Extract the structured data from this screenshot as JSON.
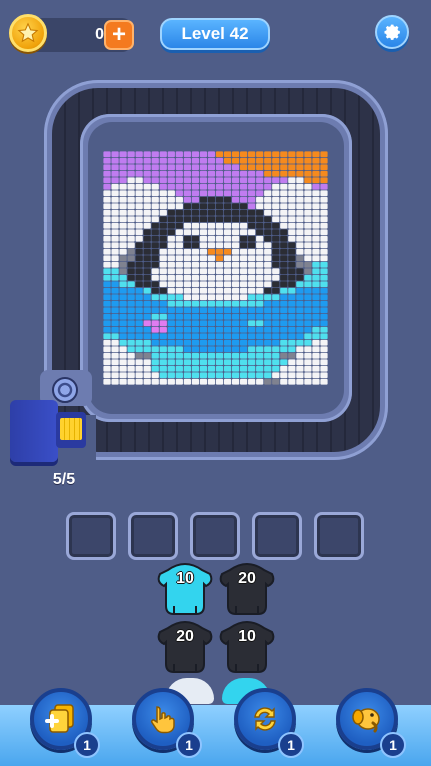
{
  "header": {
    "coins": "0",
    "coin_add_label": "+",
    "level_label": "Level 42",
    "icons": {
      "coin": "star-coin-icon",
      "settings": "gear-icon"
    }
  },
  "launcher": {
    "ammo_label": "5/5",
    "load_color": "#ffd22e"
  },
  "queue": {
    "slot_count": 5
  },
  "shooters": [
    {
      "count": "10",
      "color": "#33d4ee"
    },
    {
      "count": "20",
      "color": "#2b2d35"
    },
    {
      "count": "20",
      "color": "#2b2d35"
    },
    {
      "count": "10",
      "color": "#2b2d35"
    }
  ],
  "boosters": [
    {
      "icon": "add-blocks-icon",
      "count": "1"
    },
    {
      "icon": "tap-hand-icon",
      "count": "1"
    },
    {
      "icon": "shuffle-icon",
      "count": "1"
    },
    {
      "icon": "elephant-icon",
      "count": "1"
    }
  ],
  "palette": {
    "purple": "#c07cf0",
    "orange": "#f58a1e",
    "white": "#f4f4f6",
    "black": "#2b2d35",
    "gray": "#7f8290",
    "cyan": "#4fe0ee",
    "blue": "#1e9bf0",
    "pink": "#e07cf0",
    "peach": "#f5a35a"
  },
  "pixel_art": {
    "subject": "penguin",
    "rows": [
      "PPPPPPPPPPPPPPOOOOOOOOOOOOOO",
      "PPPPPPPPPPPPPPPOOOOOOOOOOOOO",
      "PPPPPPPPPPPPPPPPPOOOOOOOOOOO",
      "PPPPPPPPPPPPPPPPPPPPOOOOOOOO",
      "PPPWWPPPPPPPPPPPPPPPPPPWWOOO",
      "PWWWWWWPPPPPPPPPPPPPPWWWWWPP",
      "WWWWWWWWWPPPPPPPPPPPWWWWWWWW",
      "WWWWWWWWWWPPKKKKPPPWWWWWWWWW",
      "WWWWWWWWWWKKKKKKKKPWWWWWWWWW",
      "WWWWWWWWKKKKKKKKKKKKWWWWWWWW",
      "WWWWWWWKKKKKKKKKKKKKKWWWWWWW",
      "WWWWWWKKKKWWWWWWWWKKKKWWWWWW",
      "WWWWWKKKKWWWWWWWWWWKKKKWWWWW",
      "WWWWWKKKWWKKWWWWWKKWKKKWWWWW",
      "WWWWKKKKWWKKWWWWWKKWWKKKWWWW",
      "WWWGKKKWWWWWWOOOWWWWWKKKWWWW",
      "WWGGKKKWWWWWWWOWWWWWWKKKGWWW",
      "WWGKKKKWWWWWWWWWWWWWWKKKGGCC",
      "CCGKKKWWWWWWWWWWWWWWWWKKKGCC",
      "CCCKKKWWWWWWWWWWWWWWWWKKKCCC",
      "BBCCKKKWWWWWWWWWWWWWWKKKCCCC",
      "BBBBBCKKWWWWWWWWWWWWKKCCBBBB",
      "BBBBBBCCCCWWWWWWWWCCCCBBBBBB",
      "BBBBBBBBCCCCCCCCCCCCBBBBBBBB",
      "BBBBBBBBBBBBBBBBBBBBBBBBBBBB",
      "BBBBBBCCBBBBBBBBBBBBBBBBBBBB",
      "BBBBBNNNBBBBBBBBBBCCBBBBBBBB",
      "BBBBBBNNBBBBBBBBBBBBBBBBBBCC",
      "CCBBBBBBBBBBBBBBBBBBBBBBBCCC",
      "WWCCCCBBBBBBBBBBBBBBBBCCCCWW",
      "WWWCCCCCCCBBBBBBBBCCCCCCWWWW",
      "WWWWGGCCCCCCCCCCCCCCCCGGWWWW",
      "WWWWWWCCCCCCCCCCCCCCCCCWWWWW",
      "WWWWWWCCCCCCCCCCCCCCCCWWWWWW",
      "WWWWWWWCCCCCCCCCCCCCCWWWWWWW",
      "WWWWWWWWWWWWWWWWWWWWGGWWWWWW"
    ]
  }
}
